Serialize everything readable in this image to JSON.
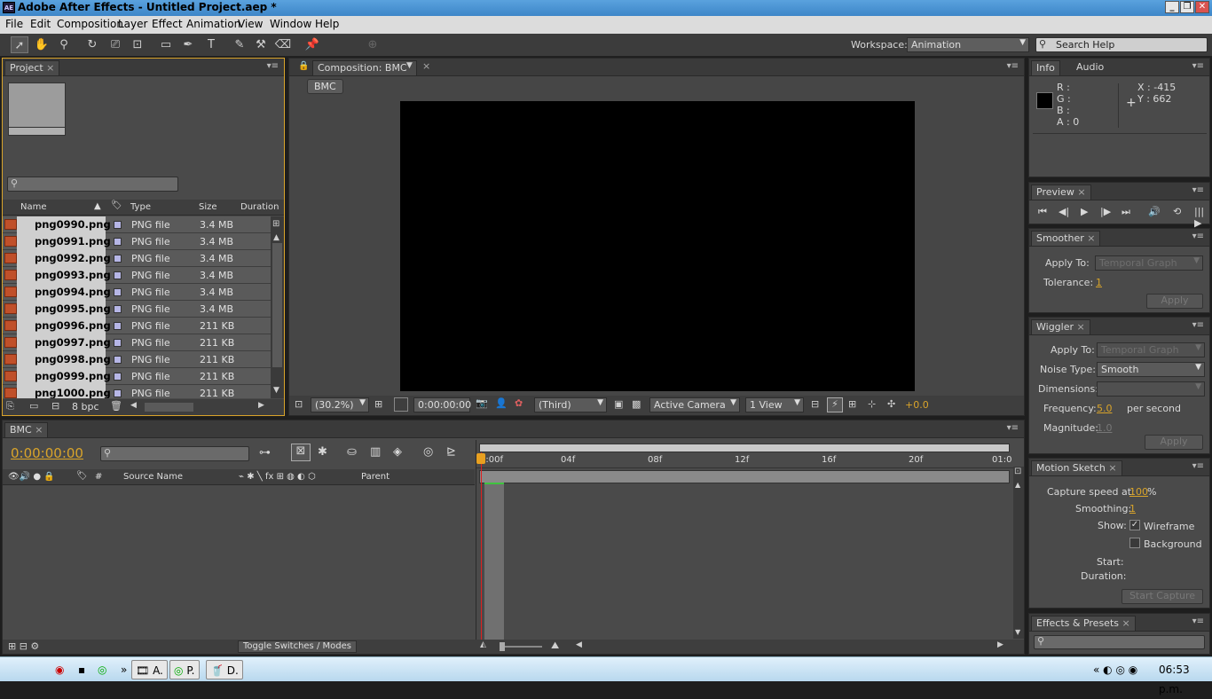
{
  "window": {
    "title": "Adobe After Effects - Untitled Project.aep *",
    "app_icon": "AE",
    "buttons": [
      "_",
      "❐",
      "✕"
    ]
  },
  "menu": [
    "File",
    "Edit",
    "Composition",
    "Layer",
    "Effect",
    "Animation",
    "View",
    "Window",
    "Help"
  ],
  "toolbar": {
    "workspace_label": "Workspace:",
    "workspace_value": "Animation",
    "search_placeholder": "Search Help"
  },
  "project": {
    "tab": "Project",
    "columns": [
      "Name",
      "Type",
      "Size",
      "Duration"
    ],
    "items": [
      {
        "name": "png0990.png",
        "type": "PNG file",
        "size": "3.4 MB"
      },
      {
        "name": "png0991.png",
        "type": "PNG file",
        "size": "3.4 MB"
      },
      {
        "name": "png0992.png",
        "type": "PNG file",
        "size": "3.4 MB"
      },
      {
        "name": "png0993.png",
        "type": "PNG file",
        "size": "3.4 MB"
      },
      {
        "name": "png0994.png",
        "type": "PNG file",
        "size": "3.4 MB"
      },
      {
        "name": "png0995.png",
        "type": "PNG file",
        "size": "3.4 MB"
      },
      {
        "name": "png0996.png",
        "type": "PNG file",
        "size": "211 KB"
      },
      {
        "name": "png0997.png",
        "type": "PNG file",
        "size": "211 KB"
      },
      {
        "name": "png0998.png",
        "type": "PNG file",
        "size": "211 KB"
      },
      {
        "name": "png0999.png",
        "type": "PNG file",
        "size": "211 KB"
      },
      {
        "name": "png1000.png",
        "type": "PNG file",
        "size": "211 KB"
      }
    ],
    "bpc": "8 bpc"
  },
  "composition": {
    "tab": "Composition: BMC",
    "crumb": "BMC",
    "zoom": "(30.2%)",
    "timecode": "0:00:00:00",
    "resolution": "(Third)",
    "camera": "Active Camera",
    "views": "1 View",
    "exposure": "+0.0"
  },
  "info": {
    "tabs": [
      "Info",
      "Audio"
    ],
    "r": "R :",
    "g": "G :",
    "b": "B :",
    "a": "A : 0",
    "x": "X : -415",
    "y": "Y : 662"
  },
  "preview": {
    "tab": "Preview"
  },
  "smoother": {
    "tab": "Smoother",
    "apply_to_label": "Apply To:",
    "apply_to": "Temporal Graph",
    "tolerance_label": "Tolerance:",
    "tolerance": "1",
    "apply": "Apply"
  },
  "wiggler": {
    "tab": "Wiggler",
    "apply_to_label": "Apply To:",
    "apply_to": "Temporal Graph",
    "noise_label": "Noise Type:",
    "noise": "Smooth",
    "dimensions_label": "Dimensions:",
    "frequency_label": "Frequency:",
    "frequency": "5.0",
    "per_second": "per second",
    "magnitude_label": "Magnitude:",
    "magnitude": "1.0",
    "apply": "Apply"
  },
  "motion_sketch": {
    "tab": "Motion Sketch",
    "capture_label": "Capture speed at:",
    "capture": "100",
    "percent": "%",
    "smoothing_label": "Smoothing:",
    "smoothing": "1",
    "show_label": "Show:",
    "wireframe": "Wireframe",
    "background": "Background",
    "start_label": "Start:",
    "duration_label": "Duration:",
    "start_capture": "Start Capture"
  },
  "effects": {
    "tab": "Effects & Presets"
  },
  "timeline": {
    "tab": "BMC",
    "timecode": "0:00:00:00",
    "ruler": [
      "0:00f",
      "04f",
      "08f",
      "12f",
      "16f",
      "20f",
      "01:0"
    ],
    "source_name": "Source Name",
    "parent": "Parent",
    "toggle": "Toggle Switches / Modes"
  },
  "taskbar": {
    "items": [
      "A.",
      "P.",
      "D."
    ],
    "clock": "06:53 p.m."
  }
}
